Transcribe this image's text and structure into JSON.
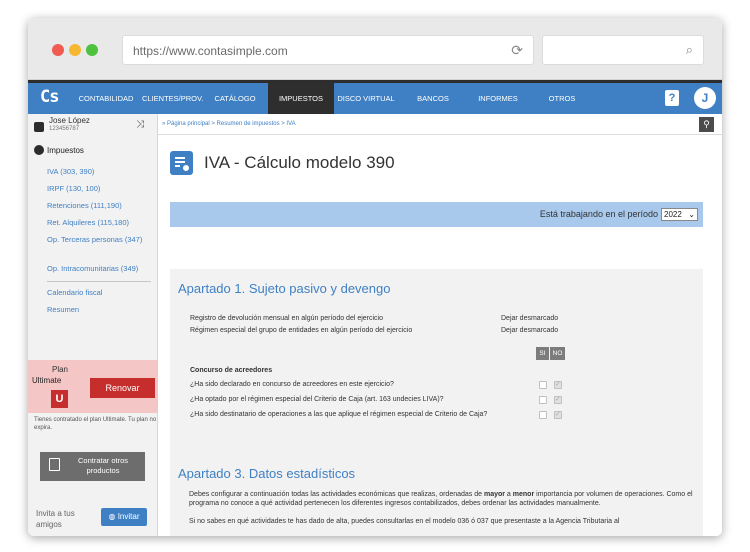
{
  "browser": {
    "url": "https://www.contasimple.com",
    "reload_icon": "⟳",
    "search_icon": "⌕"
  },
  "nav": {
    "logo": "Cs",
    "items": [
      {
        "label": "CONTABILIDAD"
      },
      {
        "label": "CLIENTES/PROV."
      },
      {
        "label": "CATÁLOGO"
      },
      {
        "label": "IMPUESTOS",
        "active": true
      },
      {
        "label": "DISCO VIRTUAL"
      },
      {
        "label": "BANCOS"
      },
      {
        "label": "INFORMES"
      },
      {
        "label": "OTROS"
      }
    ],
    "help": "?",
    "avatar": "J"
  },
  "sidebar": {
    "user_name": "Jose López",
    "user_id": "123456787",
    "section": "Impuestos",
    "links": [
      "IVA (303, 390)",
      "IRPF (130, 100)",
      "Retenciones (111,190)",
      "Ret. Alquileres (115,180)",
      "Op. Terceras personas (347)",
      "Op. Intracomunitarias (349)"
    ],
    "links2": [
      "Calendario fiscal",
      "Resumen"
    ],
    "plan": {
      "label": "Plan",
      "name": "Ultimate",
      "badge": "U",
      "renew": "Renovar",
      "note": "Tienes contratado el plan Ultimate. Tu plan no expira."
    },
    "contract": "Contratar otros productos",
    "invite_text": "Invita a tus amigos",
    "invite_btn": "Invitar"
  },
  "main": {
    "breadcrumb": "» Página principal > Resumen de impuestos > IVA",
    "title": "IVA - Cálculo modelo 390",
    "period_label": "Está trabajando en el período",
    "period_value": "2022",
    "section1": {
      "heading": "Apartado 1. Sujeto pasivo y devengo",
      "rows": [
        {
          "label": "Registro de devolución mensual en algún período del ejercicio",
          "value": "Dejar desmarcado"
        },
        {
          "label": "Régimen especial del grupo de entidades en algún período del ejercicio",
          "value": "Dejar desmarcado"
        }
      ],
      "concurso_title": "Concurso de acreedores",
      "si": "SI",
      "no": "NO",
      "questions": [
        "¿Ha sido declarado en concurso de acreedores en este ejercicio?",
        "¿Ha optado por el régimen especial del Criterio de Caja (art. 163 undecies LIVA)?",
        "¿Ha sido destinatario de operaciones a las que aplique el régimen especial de Criterio de Caja?"
      ]
    },
    "section3": {
      "heading": "Apartado 3. Datos estadísticos",
      "p1_a": "Debes configurar a continuación todas las actividades económicas que realizas, ordenadas de ",
      "p1_b": "mayor",
      "p1_c": " a ",
      "p1_d": "menor",
      "p1_e": " importancia por volumen de operaciones. Como el programa no conoce a qué actividad pertenecen los diferentes ingresos contabilizados, debes ordenar las actividades manualmente.",
      "p2": "Si no sabes en qué actividades te has dado de alta, puedes consultarlas en el modelo 036 ó 037 que presentaste a la Agencia Tributaria al"
    }
  }
}
